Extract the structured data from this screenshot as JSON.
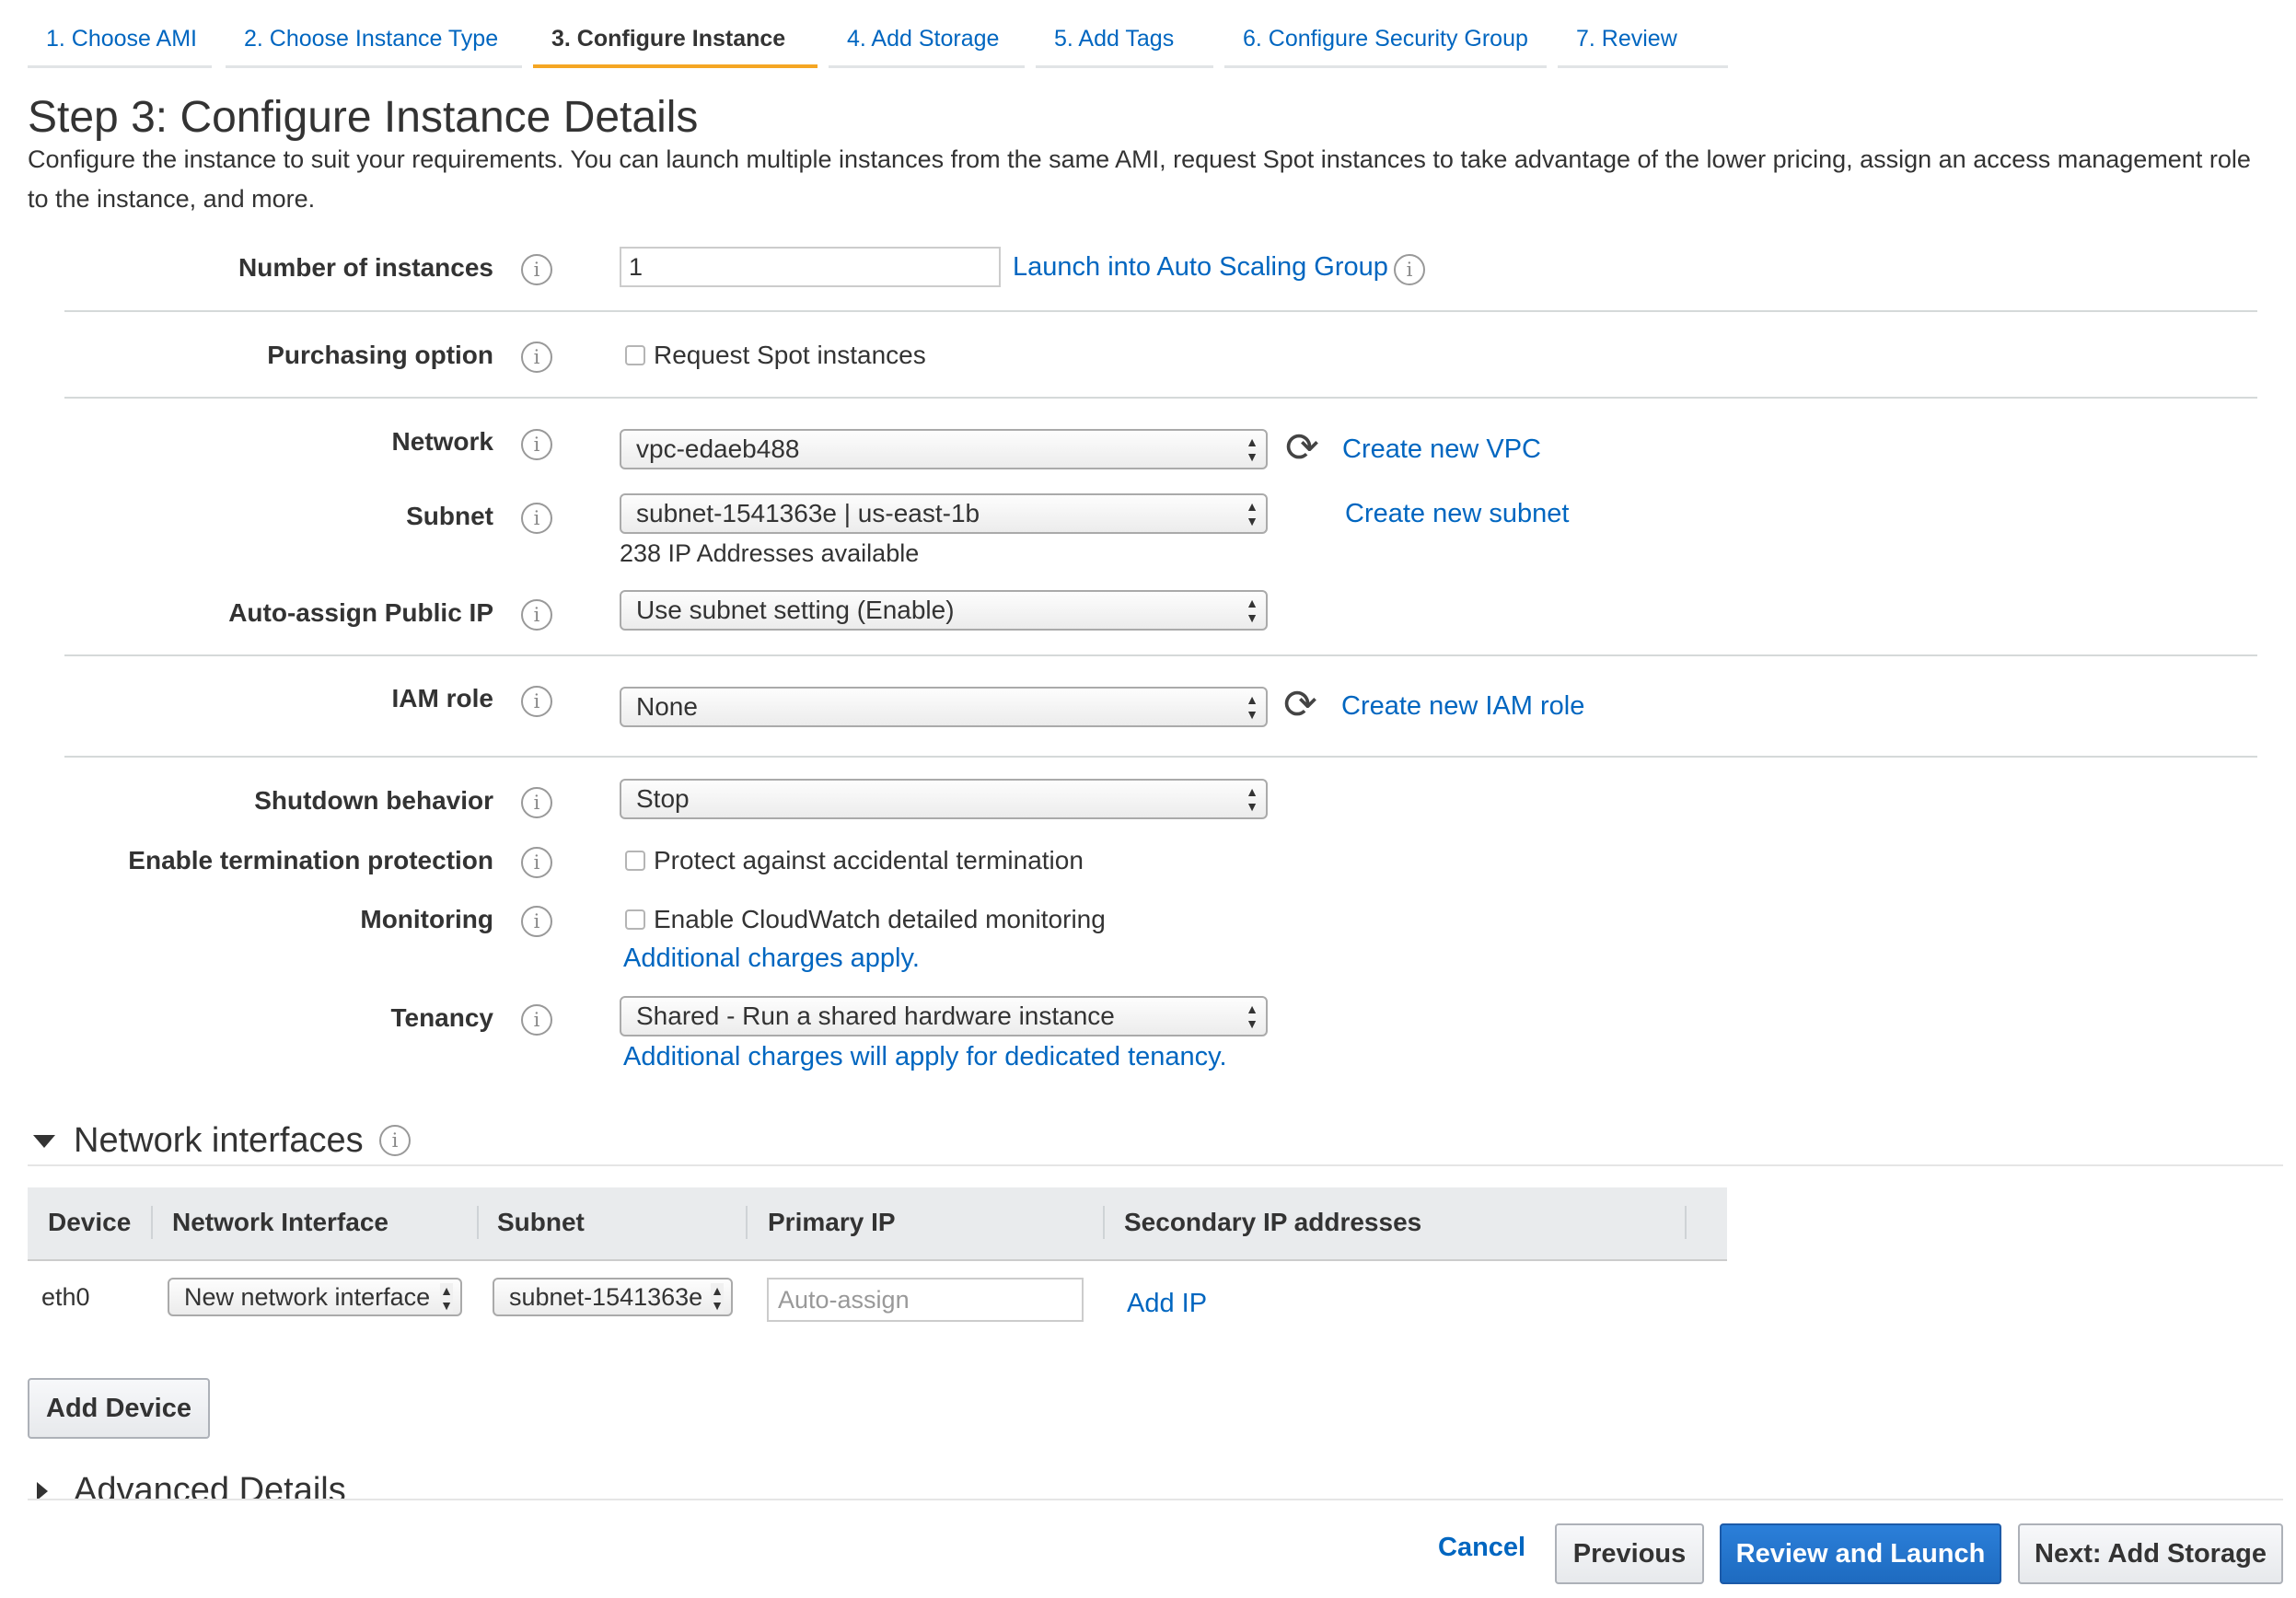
{
  "wizard": {
    "steps": [
      {
        "label": "1. Choose AMI"
      },
      {
        "label": "2. Choose Instance Type"
      },
      {
        "label": "3. Configure Instance"
      },
      {
        "label": "4. Add Storage"
      },
      {
        "label": "5. Add Tags"
      },
      {
        "label": "6. Configure Security Group"
      },
      {
        "label": "7. Review"
      }
    ],
    "active_step": 3,
    "active_color": "#f5a623"
  },
  "page": {
    "title": "Step 3: Configure Instance Details",
    "description": "Configure the instance to suit your requirements. You can launch multiple instances from the same AMI, request Spot instances to take advantage of the lower pricing, assign an access management role to the instance, and more."
  },
  "form": {
    "instances": {
      "label": "Number of instances",
      "value": "1",
      "link": "Launch into Auto Scaling Group"
    },
    "purchasing": {
      "label": "Purchasing option",
      "checkbox": "Request Spot instances"
    },
    "network": {
      "label": "Network",
      "value": "vpc-edaeb488",
      "link": "Create new VPC"
    },
    "subnet": {
      "label": "Subnet",
      "value": "subnet-1541363e | us-east-1b",
      "note": "238 IP Addresses available",
      "link": "Create new subnet"
    },
    "public_ip": {
      "label": "Auto-assign Public IP",
      "value": "Use subnet setting (Enable)"
    },
    "iam": {
      "label": "IAM role",
      "value": "None",
      "link": "Create new IAM role"
    },
    "shutdown": {
      "label": "Shutdown behavior",
      "value": "Stop"
    },
    "termination": {
      "label": "Enable termination protection",
      "checkbox": "Protect against accidental termination"
    },
    "monitoring": {
      "label": "Monitoring",
      "checkbox": "Enable CloudWatch detailed monitoring",
      "link": "Additional charges apply."
    },
    "tenancy": {
      "label": "Tenancy",
      "value": "Shared - Run a shared hardware instance",
      "link": "Additional charges will apply for dedicated tenancy."
    }
  },
  "network_interfaces": {
    "title": "Network interfaces",
    "columns": [
      "Device",
      "Network Interface",
      "Subnet",
      "Primary IP",
      "Secondary IP addresses"
    ],
    "row": {
      "device": "eth0",
      "interface": "New network interface",
      "subnet": "subnet-1541363e",
      "primary_ip_placeholder": "Auto-assign",
      "add_ip": "Add IP"
    },
    "add_device": "Add Device"
  },
  "advanced": {
    "title": "Advanced Details"
  },
  "footer": {
    "cancel": "Cancel",
    "previous": "Previous",
    "review_launch": "Review and Launch",
    "next": "Next: Add Storage",
    "primary_color": "#1e6bc0",
    "link_color": "#0066c0"
  },
  "icons": {
    "info": "i",
    "refresh": "⟳"
  }
}
